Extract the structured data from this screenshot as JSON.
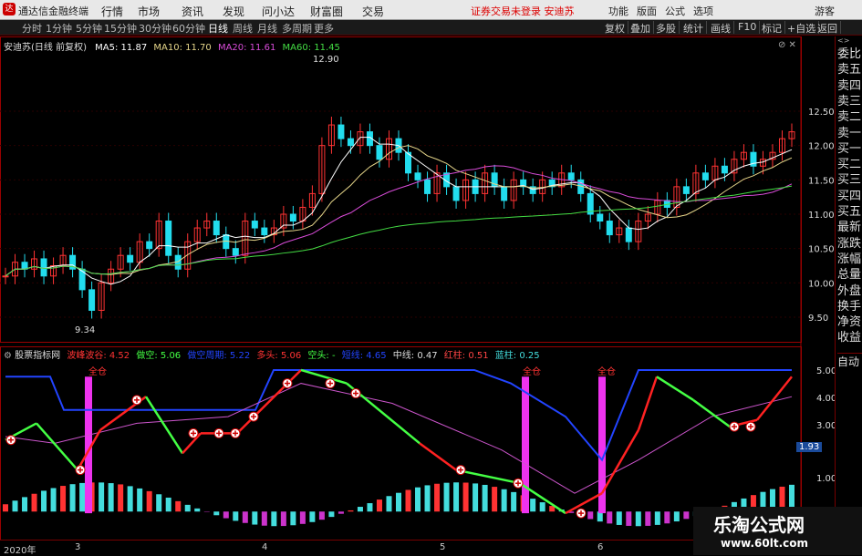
{
  "app": {
    "title": "通达信金融终端",
    "notice": "证券交易未登录  安迪苏"
  },
  "menu": [
    "行情",
    "市场",
    "资讯",
    "发现",
    "问小达",
    "财富圈",
    "交易"
  ],
  "right_menu": [
    "功能",
    "版面",
    "公式",
    "选项",
    "游客"
  ],
  "toolbar": {
    "periods": [
      "分时",
      "1分钟",
      "5分钟",
      "15分钟",
      "30分钟",
      "60分钟",
      "日线",
      "周线",
      "月线",
      "多周期",
      "更多"
    ],
    "active": "日线",
    "right_buttons": [
      "复权",
      "叠加",
      "多股",
      "统计",
      "画线",
      "F10",
      "标记",
      "+自选",
      "返回"
    ]
  },
  "main_chart": {
    "title": "安迪苏(日线 前复权)",
    "ma": [
      {
        "label": "MA5: 11.87",
        "color": "#ffffff"
      },
      {
        "label": "MA10: 11.70",
        "color": "#e6d68a"
      },
      {
        "label": "MA20: 11.61",
        "color": "#d94cd9"
      },
      {
        "label": "MA60: 11.45",
        "color": "#44dd44"
      }
    ],
    "high_label": "12.90",
    "low_label": "9.34",
    "yticks": [
      "12.50",
      "12.00",
      "11.50",
      "11.00",
      "10.50",
      "10.00",
      "9.50"
    ]
  },
  "indicator": {
    "name": "股票指标网",
    "items": [
      {
        "label": "波峰波谷: 4.52",
        "color": "#ff3333"
      },
      {
        "label": "做空: 5.06",
        "color": "#44ff44"
      },
      {
        "label": "做空周期: 5.22",
        "color": "#2244ff"
      },
      {
        "label": "多头: 5.06",
        "color": "#ff3333"
      },
      {
        "label": "空头: -",
        "color": "#44ff44"
      },
      {
        "label": "短线: 4.65",
        "color": "#2244ff"
      },
      {
        "label": "中线: 0.47",
        "color": "#dddddd"
      },
      {
        "label": "红柱: 0.51",
        "color": "#ff4444"
      },
      {
        "label": "蓝柱: 0.25",
        "color": "#44dddd"
      }
    ],
    "yticks": [
      "5.00",
      "4.00",
      "3.00",
      "1.00"
    ],
    "current": "1.93",
    "signal": "全仓"
  },
  "sidebar": [
    "委比",
    "卖五",
    "卖四",
    "卖三",
    "卖二",
    "卖一",
    "买一",
    "买二",
    "买三",
    "买四",
    "买五",
    "最新",
    "涨跌",
    "涨幅",
    "总量",
    "外盘",
    "换手",
    "净资",
    "收益",
    "自动"
  ],
  "axis_bottom": [
    "2020年",
    "3",
    "4",
    "5",
    "6"
  ],
  "watermark": {
    "line1": "乐淘公式网",
    "line2": "www.60lt.com"
  },
  "colors": {
    "up": "#ff3333",
    "down": "#22ddee",
    "ma5": "#ffffff",
    "ma10": "#e6d68a",
    "ma20": "#d94cd9",
    "ma60": "#44dd44",
    "signal_bar": "#ee33ee",
    "frame": "#990000"
  }
}
